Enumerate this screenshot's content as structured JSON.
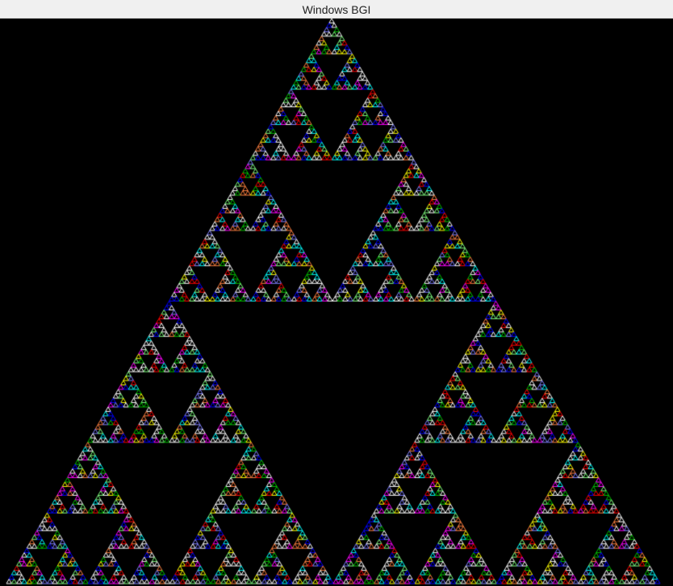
{
  "window": {
    "title": "Windows BGI"
  },
  "canvas": {
    "background_color": "#000000",
    "content": "sierpinski-triangle-fractal",
    "palette": [
      "#ffffff",
      "#ff0000",
      "#00c000",
      "#0000ff",
      "#ffff00",
      "#00ffff",
      "#ff00ff",
      "#ffffff",
      "#ffffff",
      "#ff8040",
      "#80ff80",
      "#8080ff"
    ]
  }
}
